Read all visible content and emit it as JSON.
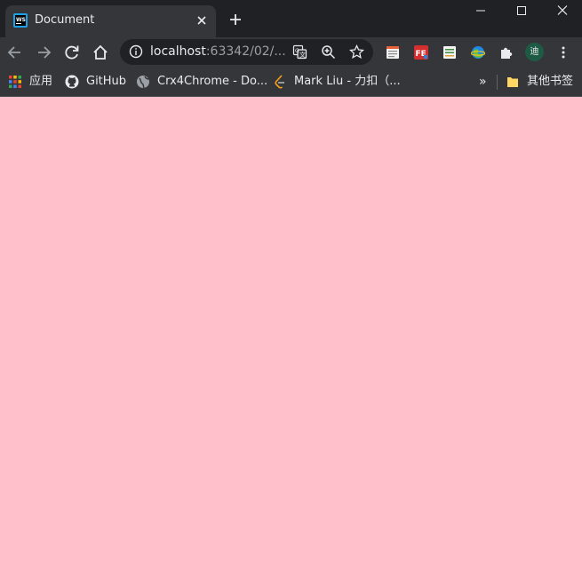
{
  "window": {
    "tab": {
      "title": "Document",
      "favicon": "webstorm-icon"
    },
    "controls": [
      "minimize-icon",
      "maximize-icon",
      "close-icon"
    ]
  },
  "toolbar": {
    "url_host": "localhost",
    "url_rest": ":63342/02/...",
    "icons": [
      "back-icon",
      "forward-icon",
      "reload-icon",
      "home-icon",
      "info-icon",
      "translate-icon",
      "zoom-icon",
      "star-icon",
      "extension-icon",
      "menu-icon"
    ]
  },
  "profile": {
    "initial": "迪"
  },
  "bookmarks": {
    "items": [
      {
        "label": "应用",
        "icon": "apps-icon"
      },
      {
        "label": "GitHub",
        "icon": "github-icon"
      },
      {
        "label": "Crx4Chrome - Do...",
        "icon": "globe-icon"
      },
      {
        "label": "Mark Liu - 力扣（...",
        "icon": "leetcode-icon"
      }
    ],
    "overflow": "»",
    "other": {
      "label": "其他书签",
      "icon": "folder-icon"
    }
  },
  "page": {
    "background": "#ffc0cb"
  }
}
